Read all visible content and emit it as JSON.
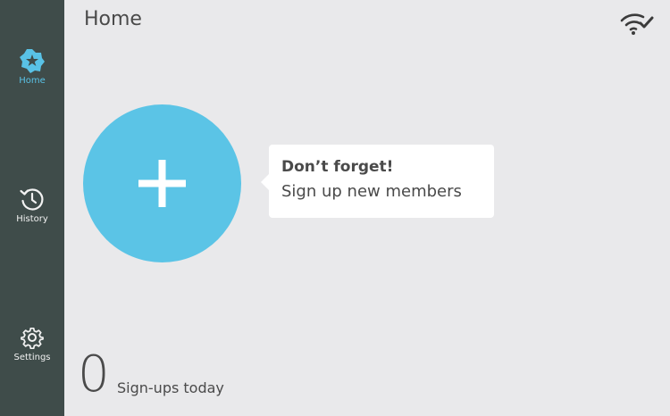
{
  "sidebar": {
    "items": [
      {
        "label": "Home",
        "icon": "star-logo-icon",
        "active": true
      },
      {
        "label": "History",
        "icon": "history-icon",
        "active": false
      },
      {
        "label": "Settings",
        "icon": "gear-icon",
        "active": false
      }
    ]
  },
  "header": {
    "title": "Home",
    "status_icon": "wifi-connected-icon"
  },
  "main": {
    "add_button_icon": "plus-icon",
    "tooltip": {
      "title": "Don’t forget!",
      "body": "Sign up new members"
    },
    "signups": {
      "count": "0",
      "label": "Sign-ups today"
    }
  },
  "colors": {
    "sidebar_bg": "#3f4c4a",
    "accent": "#5bc4e6",
    "background": "#e9e9eb",
    "text": "#4a4a4a"
  }
}
